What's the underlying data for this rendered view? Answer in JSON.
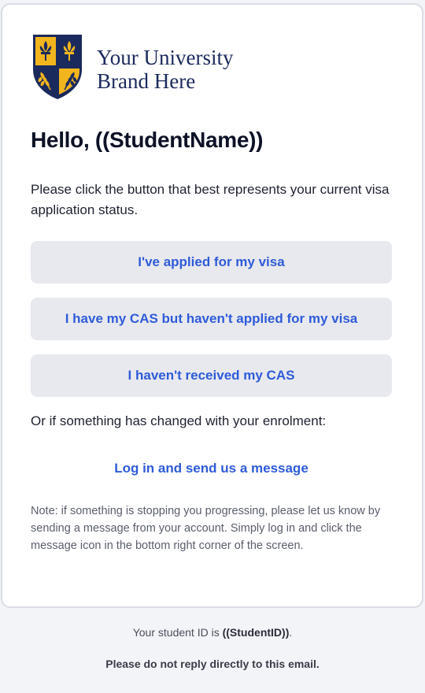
{
  "brand": {
    "line1": "Your University",
    "line2": "Brand Here",
    "colors": {
      "navy": "#1b2a5c",
      "gold": "#f2b51d"
    }
  },
  "email": {
    "greeting": "Hello, ((StudentName))",
    "intro": "Please click the button that best represents your current visa application status.",
    "buttons": [
      {
        "label": "I've applied for my visa"
      },
      {
        "label": "I have my CAS but haven't applied for my visa"
      },
      {
        "label": "I haven't received my CAS"
      }
    ],
    "changed_text": "Or if something has changed with your enrolment:",
    "login_link": "Log in and send us a message",
    "note": "Note: if something is stopping you progressing, please let us know by sending a message from your account. Simply log in and click the message icon in the bottom right corner of the screen."
  },
  "footer": {
    "id_prefix": "Your student ID is ",
    "id_value": "((StudentID))",
    "id_suffix": ".",
    "noreply": "Please do not reply directly to this email."
  },
  "colors": {
    "accent": "#2e5bd8",
    "button_bg": "#e8e9ee",
    "page_bg": "#f3f4f7"
  }
}
